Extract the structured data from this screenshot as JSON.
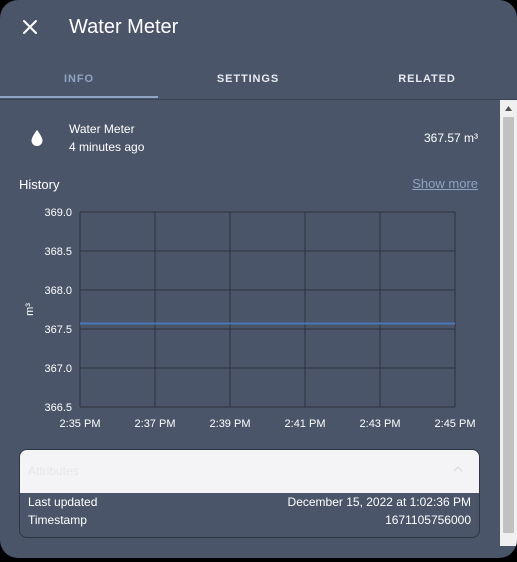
{
  "dialog": {
    "title": "Water Meter"
  },
  "tabs": [
    {
      "label": "INFO",
      "active": true
    },
    {
      "label": "SETTINGS",
      "active": false
    },
    {
      "label": "RELATED",
      "active": false
    }
  ],
  "entity": {
    "icon": "water-drop-icon",
    "name": "Water Meter",
    "last_changed": "4 minutes ago",
    "state": "367.57 m³"
  },
  "history": {
    "label": "History",
    "show_more": "Show more"
  },
  "chart_data": {
    "type": "line",
    "ylabel": "m³",
    "xlabel": "",
    "ylim": [
      366.5,
      369.0
    ],
    "yticks": [
      "369.0",
      "368.5",
      "368.0",
      "367.5",
      "367.0",
      "366.5"
    ],
    "xticks": [
      "2:35 PM",
      "2:37 PM",
      "2:39 PM",
      "2:41 PM",
      "2:43 PM",
      "2:45 PM"
    ],
    "x": [
      "2:35 PM",
      "2:45 PM"
    ],
    "series": [
      {
        "values": [
          367.57,
          367.57
        ],
        "color": "#4a78b8"
      }
    ],
    "grid": true
  },
  "attributes": {
    "header": "Attributes",
    "rows": [
      {
        "key": "Last updated",
        "value": "December 15, 2022 at 1:02:36 PM"
      },
      {
        "key": "Timestamp",
        "value": "1671105756000"
      }
    ]
  },
  "colors": {
    "background": "#4b5569",
    "accent": "#8fa3c2",
    "line": "#4a78b8"
  }
}
